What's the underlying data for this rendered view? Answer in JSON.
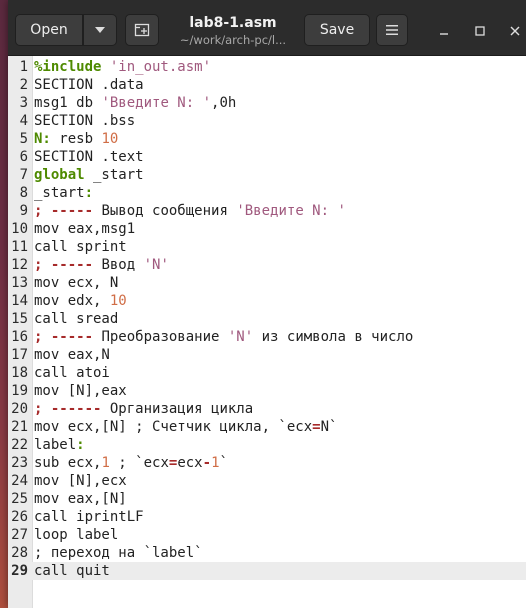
{
  "window": {
    "title": "lab8-1.asm",
    "subtitle": "~/work/arch-pc/l...",
    "open_label": "Open",
    "save_label": "Save",
    "icons": {
      "open_dropdown": "chevron-down-icon",
      "new_tab": "new-tab-icon",
      "menu": "hamburger-menu-icon",
      "minimize": "minimize-icon",
      "maximize": "maximize-icon",
      "close": "close-icon"
    }
  },
  "editor": {
    "current_line": 29,
    "colors": {
      "keyword": "#4e8a00",
      "string": "#a0597e",
      "number": "#d06d46",
      "comment_marker": "#a62a2a",
      "current_line_bg": "#ececec"
    },
    "lines": [
      [
        {
          "t": "%include ",
          "c": "kw"
        },
        {
          "t": "'in_out.asm'",
          "c": "str"
        }
      ],
      [
        {
          "t": "SECTION .data",
          "c": ""
        }
      ],
      [
        {
          "t": "msg1 db ",
          "c": ""
        },
        {
          "t": "'Введите N: '",
          "c": "str"
        },
        {
          "t": ",0h",
          "c": ""
        }
      ],
      [
        {
          "t": "SECTION .bss",
          "c": ""
        }
      ],
      [
        {
          "t": "N:",
          "c": "kw"
        },
        {
          "t": " resb ",
          "c": ""
        },
        {
          "t": "10",
          "c": "num"
        }
      ],
      [
        {
          "t": "SECTION .text",
          "c": ""
        }
      ],
      [
        {
          "t": "global",
          "c": "kw"
        },
        {
          "t": " _start",
          "c": ""
        }
      ],
      [
        {
          "t": "_start",
          "c": ""
        },
        {
          "t": ":",
          "c": "kw"
        }
      ],
      [
        {
          "t": "; -----",
          "c": "cm"
        },
        {
          "t": " Вывод сообщения ",
          "c": "cmtxt"
        },
        {
          "t": "'Введите N: '",
          "c": "str"
        }
      ],
      [
        {
          "t": "mov eax,msg1",
          "c": ""
        }
      ],
      [
        {
          "t": "call sprint",
          "c": ""
        }
      ],
      [
        {
          "t": "; -----",
          "c": "cm"
        },
        {
          "t": " Ввод ",
          "c": "cmtxt"
        },
        {
          "t": "'N'",
          "c": "str"
        }
      ],
      [
        {
          "t": "mov ecx, N",
          "c": ""
        }
      ],
      [
        {
          "t": "mov edx, ",
          "c": ""
        },
        {
          "t": "10",
          "c": "num"
        }
      ],
      [
        {
          "t": "call sread",
          "c": ""
        }
      ],
      [
        {
          "t": "; -----",
          "c": "cm"
        },
        {
          "t": " Преобразование ",
          "c": "cmtxt"
        },
        {
          "t": "'N'",
          "c": "str"
        },
        {
          "t": " из символа в число",
          "c": "cmtxt"
        }
      ],
      [
        {
          "t": "mov eax,N",
          "c": ""
        }
      ],
      [
        {
          "t": "call atoi",
          "c": ""
        }
      ],
      [
        {
          "t": "mov [N],eax",
          "c": ""
        }
      ],
      [
        {
          "t": "; ------",
          "c": "cm"
        },
        {
          "t": " Организация цикла",
          "c": "cmtxt"
        }
      ],
      [
        {
          "t": "mov ecx,[N] ; Счетчик цикла, `ecx",
          "c": ""
        },
        {
          "t": "=",
          "c": "op"
        },
        {
          "t": "N`",
          "c": ""
        }
      ],
      [
        {
          "t": "label",
          "c": ""
        },
        {
          "t": ":",
          "c": "kw"
        }
      ],
      [
        {
          "t": "sub ecx,",
          "c": ""
        },
        {
          "t": "1",
          "c": "num"
        },
        {
          "t": " ; `ecx",
          "c": ""
        },
        {
          "t": "=",
          "c": "op"
        },
        {
          "t": "ecx",
          "c": ""
        },
        {
          "t": "-",
          "c": "op"
        },
        {
          "t": "1",
          "c": "num"
        },
        {
          "t": "`",
          "c": ""
        }
      ],
      [
        {
          "t": "mov [N],ecx",
          "c": ""
        }
      ],
      [
        {
          "t": "mov eax,[N]",
          "c": ""
        }
      ],
      [
        {
          "t": "call iprintLF",
          "c": ""
        }
      ],
      [
        {
          "t": "loop label",
          "c": ""
        }
      ],
      [
        {
          "t": "; переход на `label`",
          "c": ""
        }
      ],
      [
        {
          "t": "call quit",
          "c": ""
        }
      ]
    ]
  }
}
